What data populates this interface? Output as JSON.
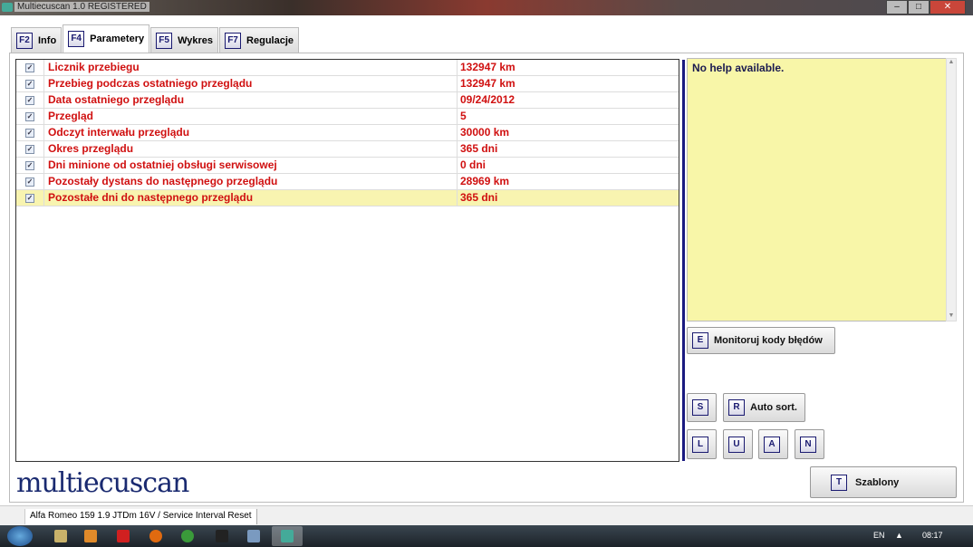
{
  "window": {
    "title": "Multiecuscan 1.0 REGISTERED"
  },
  "tabs": [
    {
      "key": "F2",
      "label": "Info"
    },
    {
      "key": "F4",
      "label": "Parametery",
      "active": true
    },
    {
      "key": "F5",
      "label": "Wykres"
    },
    {
      "key": "F7",
      "label": "Regulacje"
    }
  ],
  "parameters": [
    {
      "name": "Licznik przebiegu",
      "value": "132947 km"
    },
    {
      "name": "Przebieg podczas ostatniego przeglądu",
      "value": "132947 km"
    },
    {
      "name": "Data ostatniego przeglądu",
      "value": "09/24/2012"
    },
    {
      "name": "Przegląd",
      "value": "5"
    },
    {
      "name": "Odczyt interwału przeglądu",
      "value": "30000 km"
    },
    {
      "name": "Okres przeglądu",
      "value": "365 dni"
    },
    {
      "name": "Dni minione od ostatniej obsługi serwisowej",
      "value": "0 dni"
    },
    {
      "name": "Pozostały dystans do następnego przeglądu",
      "value": "28969 km"
    },
    {
      "name": "Pozostałe dni do następnego przeglądu",
      "value": "365 dni"
    }
  ],
  "help": {
    "text": "No help available."
  },
  "buttons": {
    "monitor": {
      "key": "E",
      "label": "Monitoruj kody błędów"
    },
    "s": {
      "key": "S"
    },
    "autosort": {
      "key": "R",
      "label": "Auto sort."
    },
    "l": {
      "key": "L"
    },
    "u": {
      "key": "U"
    },
    "a": {
      "key": "A"
    },
    "n": {
      "key": "N"
    },
    "templates": {
      "key": "T",
      "label": "Szablony"
    }
  },
  "logo": "multiecuscan",
  "status": "Alfa Romeo 159 1.9 JTDm 16V / Service Interval Reset",
  "taskbar": {
    "lang": "EN",
    "time": "08:17"
  },
  "checkmark": "✓"
}
